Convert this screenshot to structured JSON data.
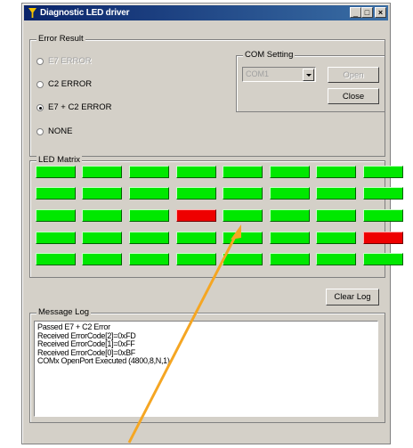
{
  "window": {
    "title": "Diagnostic LED driver",
    "controls": {
      "minimize": "_",
      "maximize": "□",
      "close": "×"
    }
  },
  "error_result": {
    "label": "Error Result",
    "options": [
      {
        "label": "E7 ERROR",
        "selected": false,
        "enabled": false
      },
      {
        "label": "C2 ERROR",
        "selected": false,
        "enabled": true
      },
      {
        "label": "E7 + C2 ERROR",
        "selected": true,
        "enabled": true
      },
      {
        "label": "NONE",
        "selected": false,
        "enabled": true
      }
    ]
  },
  "com_setting": {
    "label": "COM Setting",
    "port_value": "COM1",
    "open_label": "Open",
    "close_label": "Close"
  },
  "led_matrix": {
    "label": "LED Matrix",
    "rows": [
      [
        "green",
        "green",
        "green",
        "green",
        "green",
        "green",
        "green",
        "green"
      ],
      [
        "green",
        "green",
        "green",
        "green",
        "green",
        "green",
        "green",
        "green"
      ],
      [
        "green",
        "green",
        "green",
        "red",
        "green",
        "green",
        "green",
        "green"
      ],
      [
        "green",
        "green",
        "green",
        "green",
        "green",
        "green",
        "green",
        "red"
      ],
      [
        "green",
        "green",
        "green",
        "green",
        "green",
        "green",
        "green",
        "green"
      ]
    ]
  },
  "clear_log_label": "Clear Log",
  "message_log": {
    "label": "Message Log",
    "lines": [
      "Passed E7 + C2 Error",
      "Received ErrorCode[2]=0xFD",
      "Received ErrorCode[1]=0xFF",
      "Received ErrorCode[0]=0xBF",
      "COMx OpenPort Executed (4800,8,N,1)"
    ]
  },
  "colors": {
    "led_on": "#00e800",
    "led_error": "#ee0000",
    "annotation_arrow": "#f5a623",
    "titlebar": "#0a246a"
  },
  "icons": {
    "app": "app-icon",
    "combo_arrow": "chevron-down-icon"
  }
}
